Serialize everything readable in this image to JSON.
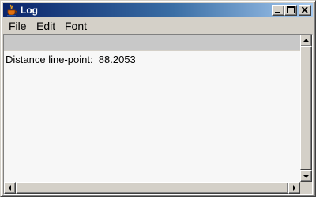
{
  "window": {
    "title": "Log",
    "icon": "java-cup-icon",
    "controls": {
      "minimize_icon": "minimize-icon",
      "maximize_icon": "maximize-icon",
      "close_icon": "close-icon"
    }
  },
  "menubar": {
    "items": [
      {
        "label": "File"
      },
      {
        "label": "Edit"
      },
      {
        "label": "Font"
      }
    ]
  },
  "log": {
    "lines": [
      "Distance line-point:  88.2053"
    ]
  },
  "colors": {
    "titlebar_start": "#0a246a",
    "titlebar_end": "#a6caf0",
    "window_face": "#d4d0c8",
    "text_background": "#f7f7f7"
  }
}
